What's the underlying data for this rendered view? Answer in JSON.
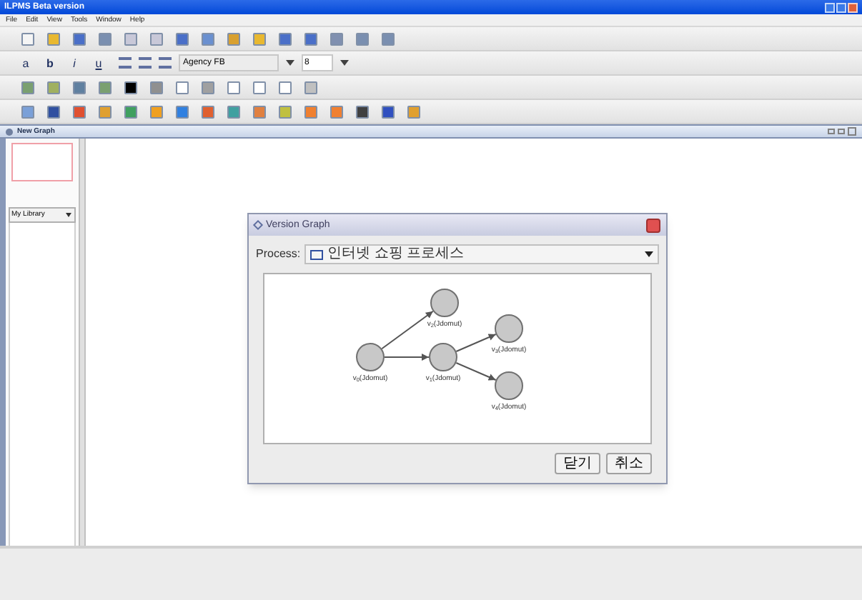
{
  "window": {
    "title": "ILPMS Beta version"
  },
  "menu": [
    "File",
    "Edit",
    "View",
    "Tools",
    "Window",
    "Help"
  ],
  "toolbars": [
    {
      "kind": "icons",
      "icons": [
        {
          "color": "#f5f5f5"
        },
        {
          "color": "#e8b830"
        },
        {
          "color": "#4a6fc8"
        },
        {
          "color": "#7a8fb0"
        },
        {
          "color": "#c8c8d8"
        },
        {
          "color": "#c8c8d8"
        },
        {
          "color": "#4a6fc8"
        },
        {
          "color": "#6a90d0"
        },
        {
          "color": "#d8a030"
        },
        {
          "color": "#e8b830"
        },
        {
          "color": "#4a6fc8"
        },
        {
          "color": "#4a6fc8"
        },
        {
          "color": "#8090b0"
        },
        {
          "color": "#7a8fb0"
        },
        {
          "color": "#7a8fb0"
        }
      ]
    },
    {
      "kind": "format",
      "styles": [
        "a",
        "b",
        "i",
        "u"
      ],
      "font": "Agency FB",
      "size": "8"
    },
    {
      "kind": "icons",
      "icons": [
        {
          "color": "#7aa070"
        },
        {
          "color": "#a0b060"
        },
        {
          "color": "#6080a0"
        },
        {
          "color": "#7aa070"
        },
        {
          "color": "#000000"
        },
        {
          "color": "#909090"
        },
        {
          "color": "#ffffff"
        },
        {
          "color": "#a0a0a0"
        },
        {
          "color": "#ffffff"
        },
        {
          "color": "#ffffff"
        },
        {
          "color": "#ffffff"
        },
        {
          "color": "#c0c0c0"
        }
      ]
    },
    {
      "kind": "icons",
      "icons": [
        {
          "color": "#7aa0d8"
        },
        {
          "color": "#3050a0"
        },
        {
          "color": "#e05030"
        },
        {
          "color": "#e0a030"
        },
        {
          "color": "#40a060"
        },
        {
          "color": "#f0a020"
        },
        {
          "color": "#3080e0"
        },
        {
          "color": "#e06030"
        },
        {
          "color": "#40a0a0"
        },
        {
          "color": "#e08040"
        },
        {
          "color": "#c0c040"
        },
        {
          "color": "#f08030"
        },
        {
          "color": "#f08031"
        },
        {
          "color": "#404040"
        },
        {
          "color": "#3050c0"
        },
        {
          "color": "#e0a030"
        }
      ]
    }
  ],
  "document": {
    "title": "New Graph"
  },
  "library": {
    "value": "My Library"
  },
  "dialog": {
    "title": "Version Graph",
    "process_label": "Process:",
    "process_value": "인터넷 쇼핑 프로세스",
    "graph": {
      "label": "v$_{0}$(Jdomut)",
      "children": [
        {
          "label": "v$_{2}$(Jdomut)"
        },
        {
          "label": "v$_{1}$(Jdomut)",
          "children": [
            {
              "label": "v$_{3}$(Jdomut)"
            },
            {
              "label": "v$_{4}$(Jdomut)"
            }
          ]
        }
      ]
    },
    "buttons": [
      "닫기",
      "취소"
    ]
  }
}
